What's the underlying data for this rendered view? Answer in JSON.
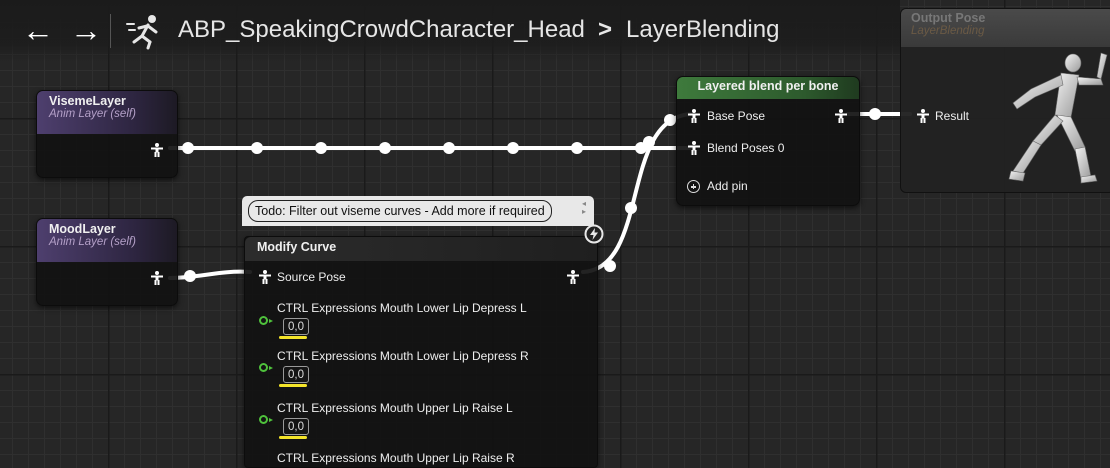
{
  "toolbar": {
    "back_label": "←",
    "forward_label": "→",
    "breadcrumb": [
      "ABP_SpeakingCrowdCharacter_Head",
      "LayerBlending"
    ],
    "separator": ">"
  },
  "nodes": {
    "viseme_layer": {
      "title": "VisemeLayer",
      "subtitle": "Anim Layer (self)"
    },
    "mood_layer": {
      "title": "MoodLayer",
      "subtitle": "Anim Layer (self)"
    },
    "layered_blend": {
      "title": "Layered blend per bone",
      "pins": [
        "Base Pose",
        "Blend Poses 0"
      ],
      "add_pin_label": "Add pin"
    },
    "output_pose": {
      "title": "Output Pose",
      "subtitle": "LayerBlending",
      "result_label": "Result"
    },
    "modify_curve": {
      "title": "Modify Curve",
      "source_pin": "Source Pose",
      "curves": [
        {
          "name": "CTRL Expressions Mouth Lower Lip Depress L",
          "value": "0,0"
        },
        {
          "name": "CTRL Expressions Mouth Lower Lip Depress R",
          "value": "0,0"
        },
        {
          "name": "CTRL Expressions Mouth Upper Lip Raise L",
          "value": "0,0"
        },
        {
          "name": "CTRL Expressions Mouth Upper Lip Raise R",
          "value": ""
        }
      ]
    }
  },
  "comment": {
    "text": "Todo: Filter out viseme curves  - Add more if required"
  },
  "colors": {
    "accent_highlight": "#f4e42a",
    "curve_pin": "#4fc23c",
    "anim_layer_header": "#4e3f6e",
    "blend_header": "#3e7a3c",
    "wire": "#ffffff"
  }
}
